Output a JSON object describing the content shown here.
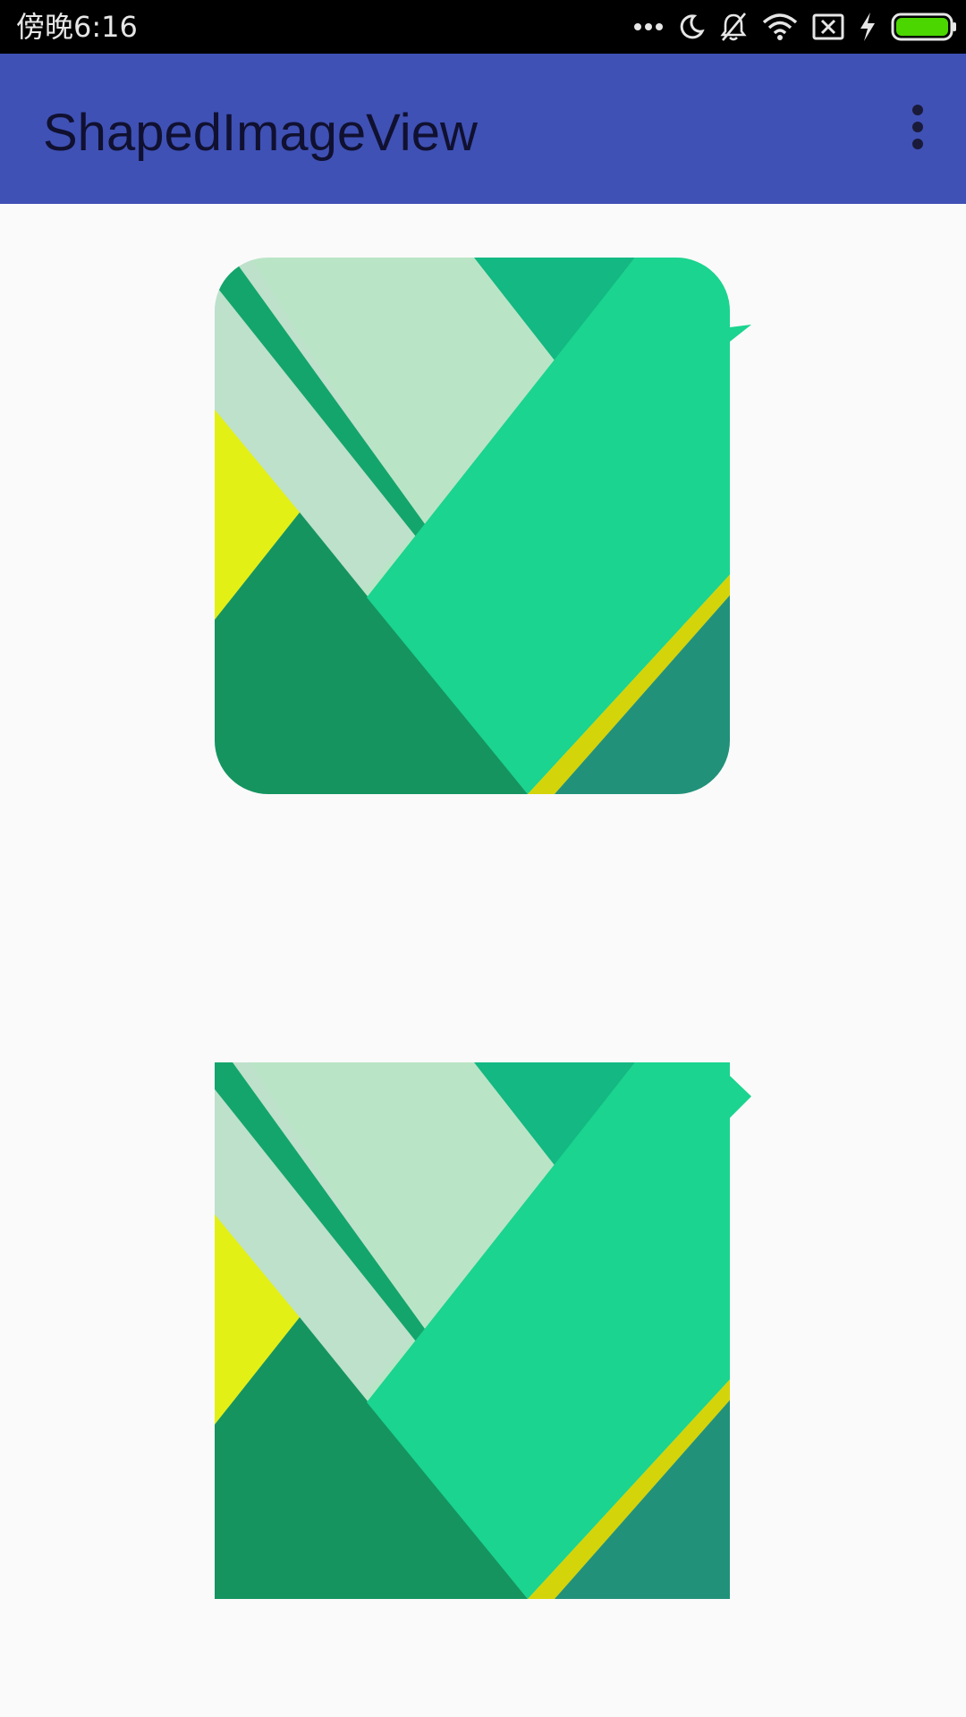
{
  "status_bar": {
    "time": "傍晚6:16",
    "icons": [
      "more-dots-icon",
      "moon-icon",
      "bell-off-icon",
      "wifi-icon",
      "sim-error-icon",
      "charging-bolt-icon",
      "battery-icon"
    ],
    "battery_color": "#4cd600"
  },
  "app_bar": {
    "title": "ShapedImageView",
    "background": "#3f51b5",
    "overflow_icon": "overflow-menu-icon"
  },
  "images": [
    {
      "name": "rounded-shaped-image",
      "shape": "rounded rectangle with pointer"
    },
    {
      "name": "square-shaped-image",
      "shape": "rectangle with pointer"
    }
  ],
  "colors": {
    "light_green": "#b9e5c6",
    "pale_green": "#bde1cb",
    "mint": "#1ad48f",
    "emerald": "#13b882",
    "dark_green": "#159460",
    "teal": "#22917a",
    "yellow": "#e3f015",
    "gold": "#d4d40a"
  }
}
